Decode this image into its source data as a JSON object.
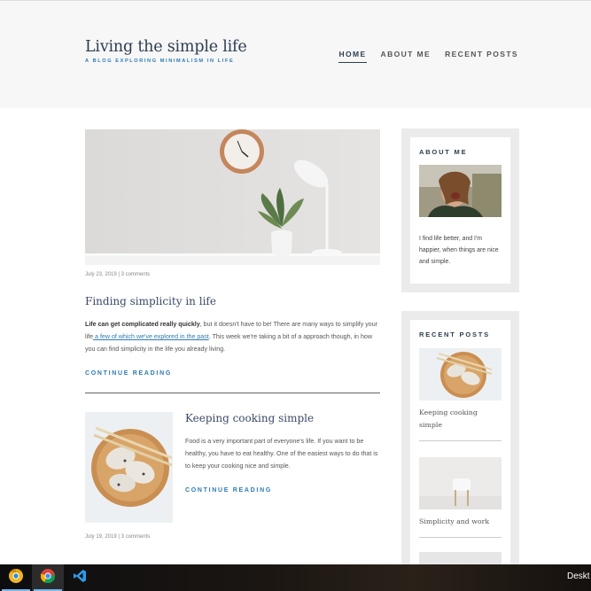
{
  "header": {
    "site_title": "Living the simple life",
    "tagline": "A BLOG EXPLORING MINIMALISM IN LIFE",
    "nav": [
      {
        "label": "HOME",
        "active": true
      },
      {
        "label": "ABOUT ME",
        "active": false
      },
      {
        "label": "RECENT POSTS",
        "active": false
      }
    ]
  },
  "posts": [
    {
      "meta": "July 23, 2019 | 3 comments",
      "title": "Finding simplicity in life",
      "excerpt_bold": "Life can get complicated really quickly",
      "excerpt_a": ", but it doesn't have to be! There are many ways to simplify your life",
      "excerpt_link": " a few of which we've explored in the past",
      "excerpt_b": ". This week we're taking a bit of a approach though, in how you can find simplicity in the life you already living.",
      "continue": "CONTINUE READING"
    },
    {
      "meta": "July 19, 2019 | 3 comments",
      "title": "Keeping cooking simple",
      "excerpt": "Food is a very important part of everyone's life. If you want to be healthy, you have to eat healthy. One of the easiest ways to do that is to keep your cooking nice and simple.",
      "continue": "CONTINUE READING"
    }
  ],
  "sidebar": {
    "about": {
      "title": "ABOUT ME",
      "text": "I find life better, and I'm happier, when things are nice and simple."
    },
    "recent": {
      "title": "RECENT POSTS",
      "items": [
        {
          "title": "Keeping cooking simple"
        },
        {
          "title": "Simplicity and work"
        }
      ]
    }
  },
  "taskbar": {
    "apps": [
      "chrome-canary-icon",
      "chrome-icon",
      "vscode-icon"
    ],
    "desktop_label": "Deskt"
  },
  "colors": {
    "accent": "#2d7ab4",
    "title": "#2c3e50",
    "header_bg": "#f7f7f7",
    "widget_bg": "#ebebeb"
  }
}
